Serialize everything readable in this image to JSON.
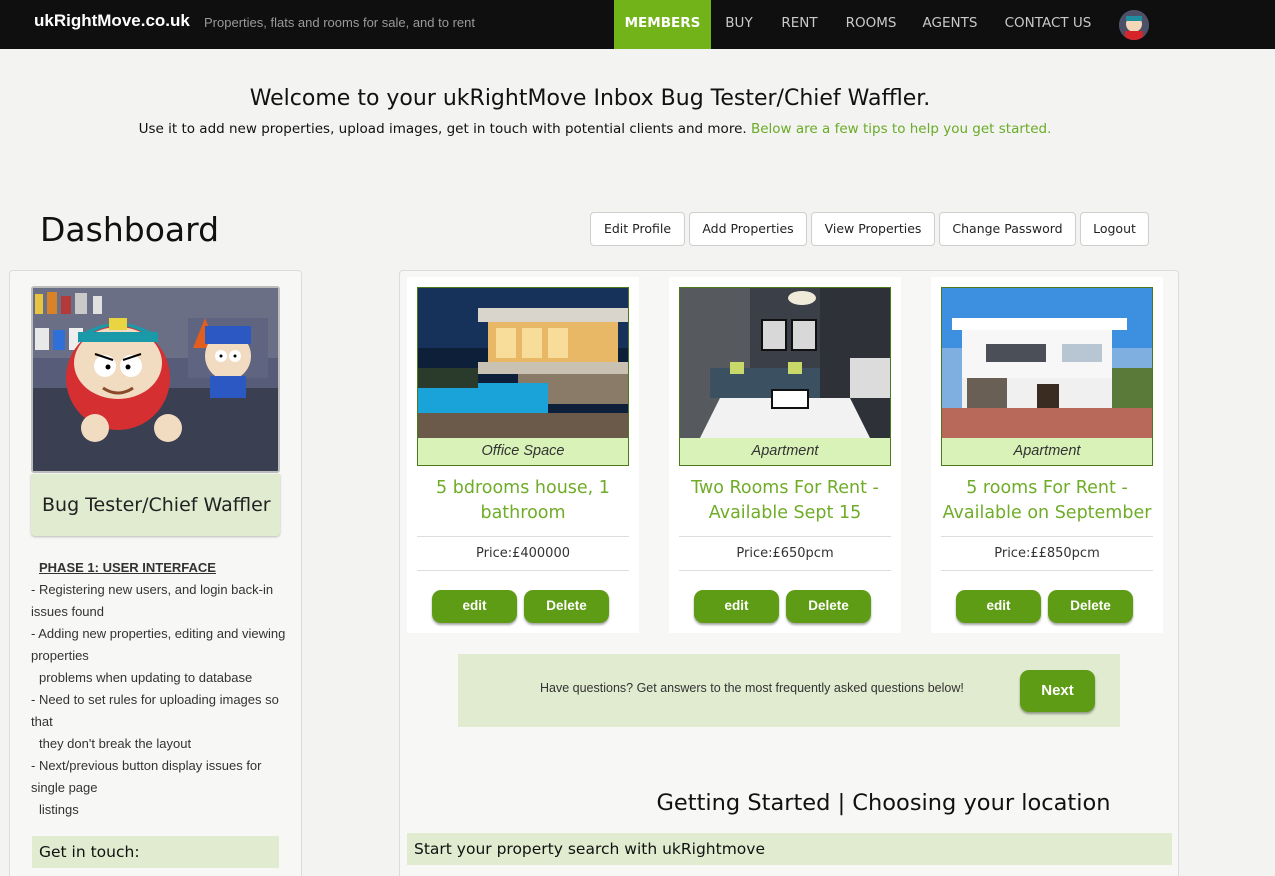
{
  "brand": "ukRightMove.co.uk",
  "tagline": "Properties, flats and rooms for sale, and to rent",
  "nav": [
    "MEMBERS",
    "BUY",
    "RENT",
    "ROOMS",
    "AGENTS",
    "CONTACT US"
  ],
  "welcome": {
    "title": "Welcome to your ukRightMove Inbox Bug Tester/Chief Waffler.",
    "subtitle": "Use it to add new properties, upload images, get in touch with potential clients and more.",
    "tip_link": "Below are a few tips to help you get started."
  },
  "dashboard": {
    "title": "Dashboard",
    "buttons": [
      "Edit Profile",
      "Add Properties",
      "View Properties",
      "Change Password",
      "Logout"
    ]
  },
  "profile": {
    "name": "Bug Tester/Chief Waffler"
  },
  "notes": {
    "heading": "PHASE 1: USER INTERFACE",
    "lines": [
      "- Registering new users, and login back-in issues found",
      "- Adding new properties, editing and viewing properties",
      "problems when updating to database",
      "- Need to set rules for uploading images so that",
      "they don't break the layout",
      "- Next/previous button display issues for single page",
      "listings"
    ]
  },
  "get_in_touch": "Get in touch:",
  "properties": [
    {
      "type": "Office Space",
      "title": "5 bdrooms house, 1 bathroom",
      "price": "Price:£400000",
      "edit": "edit",
      "delete": "Delete"
    },
    {
      "type": "Apartment",
      "title": "Two Rooms For Rent - Available Sept 15",
      "price": "Price:£650pcm",
      "edit": "edit",
      "delete": "Delete"
    },
    {
      "type": "Apartment",
      "title": "5 rooms For Rent - Available on September",
      "price": "Price:££850pcm",
      "edit": "edit",
      "delete": "Delete"
    }
  ],
  "faq": {
    "text": "Have questions? Get answers to the most frequently asked questions below!",
    "next": "Next"
  },
  "getting_started": {
    "title": "Getting Started | Choosing your location",
    "bar": "Start your property search with ukRightmove"
  },
  "colors": {
    "accent": "#72b31a",
    "button": "#5f9c15",
    "panel": "#e0ebd0",
    "type_band": "#d9f2b8"
  }
}
